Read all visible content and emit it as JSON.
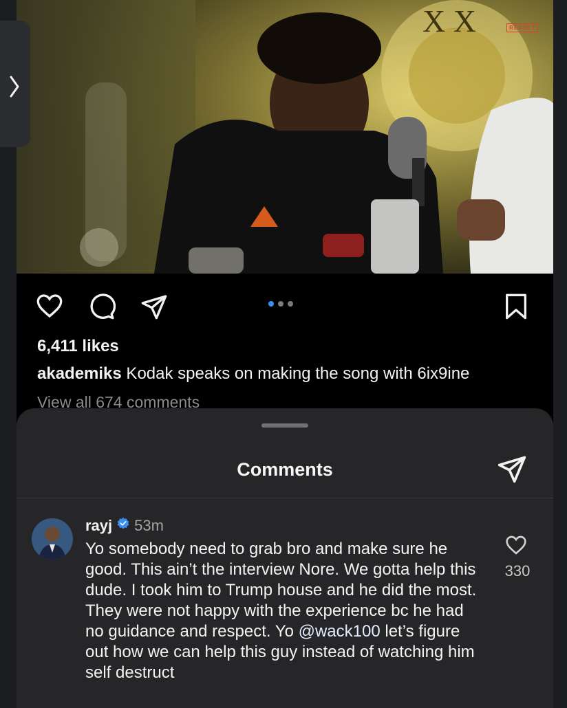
{
  "post": {
    "watermark": "REVOLT",
    "likes": "6,411 likes",
    "caption_user": "akademiks",
    "caption_text": " Kodak speaks on making the song with 6ix9ine",
    "view_all": "View all 674 comments",
    "carousel": {
      "count": 3,
      "active": 1
    },
    "icons": [
      "heart-icon",
      "comment-icon",
      "share-icon",
      "bookmark-icon"
    ]
  },
  "sheet": {
    "title": "Comments",
    "comment": {
      "user": "rayj",
      "verified": true,
      "time": "53m",
      "text_before": "Yo somebody need to grab bro and make sure he good. This ain’t the interview Nore. We gotta help this dude. I took him to Trump house and he did the most. They were not happy with the experience bc he had no guidance and respect. Yo ",
      "mention": "@wack100",
      "text_after": " let’s figure out how we can help this guy instead of watching him self destruct",
      "like_count": "330"
    }
  },
  "colors": {
    "background": "#000000",
    "sheet": "#262628",
    "accent": "#3a8ff5",
    "muted": "#8b8b8b"
  }
}
